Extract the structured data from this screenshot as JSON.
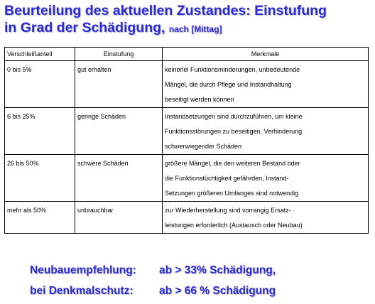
{
  "title": {
    "line1": "Beurteilung des aktuellen Zustandes: Einstufung",
    "line2_main": "in Grad der Schädigung,",
    "line2_source": "nach [Mittag]"
  },
  "table": {
    "headers": [
      "Verschleißanteil",
      "Einstufung",
      "Merkmale"
    ],
    "rows": [
      {
        "anteil": "0 bis 5%",
        "einstufung": "gut erhalten",
        "merkmale": [
          "keinerlei Funktionsminderungen, unbedeutende",
          "Mängel, die durch Pflege und Instandhaltung",
          "beseitigt werden können"
        ]
      },
      {
        "anteil": "6 bis 25%",
        "einstufung": "geringe Schäden",
        "merkmale": [
          "Instandsetzungen sind durchzuführen, um kleine",
          "Funktionsstörungen zu beseitigen, Verhinderung",
          "schwerwiegender Schäden"
        ]
      },
      {
        "anteil": "26 bis 50%",
        "einstufung": "schwere Schäden",
        "merkmale": [
          "größere Mängel, die den weiteren Bestand oder",
          "die Funktionstüchtigkeit gefährden, Instand-",
          "Setzungen größeren Umfanges sind notwendig"
        ]
      },
      {
        "anteil": "mehr als 50%",
        "einstufung": "unbrauchbar",
        "merkmale": [
          "zur Wiederherstellung sind vorrangig Ersatz-",
          "leistungen erforderlich (Austausch oder Neubau)"
        ]
      }
    ]
  },
  "recommendations": [
    {
      "label": "Neubauempfehlung:",
      "value": "ab > 33% Schädigung,"
    },
    {
      "label": "bei Denkmalschutz:",
      "value": "ab > 66 % Schädigung"
    }
  ],
  "colors": {
    "title": "#2a2ad8",
    "text": "#000000",
    "background": "#ffffff"
  }
}
